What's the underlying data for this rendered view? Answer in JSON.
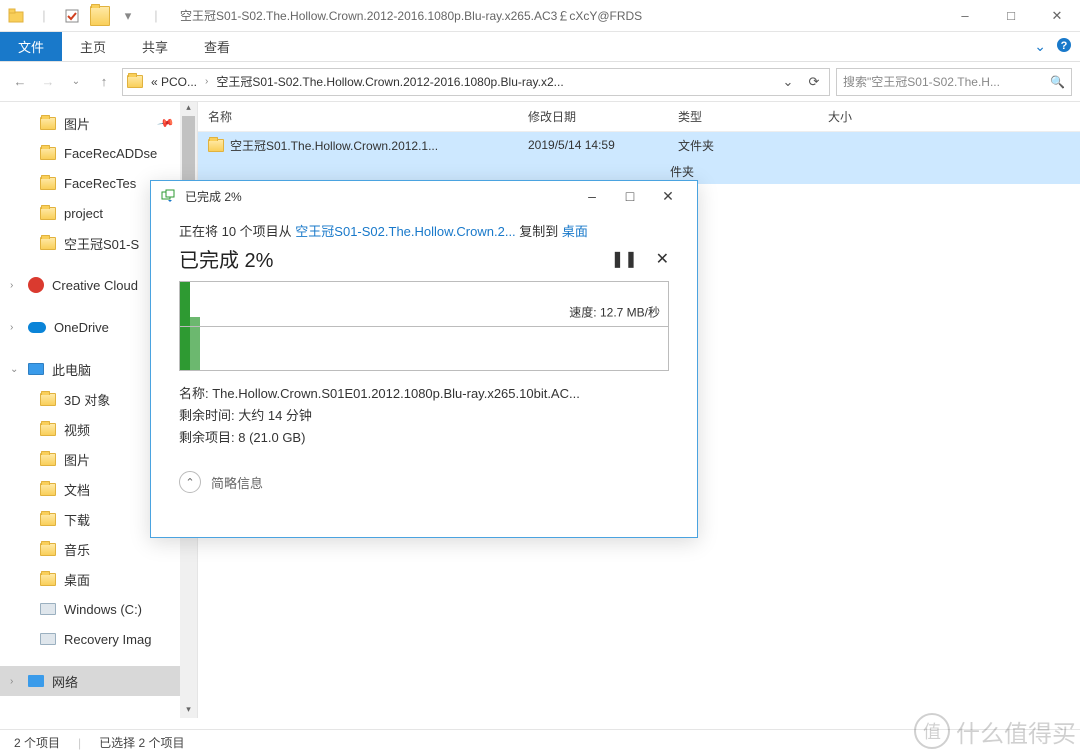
{
  "titlebar": {
    "title": "空王冠S01-S02.The.Hollow.Crown.2012-2016.1080p.Blu-ray.x265.AC3￡cXcY@FRDS"
  },
  "ribbon": {
    "file": "文件",
    "tabs": [
      "主页",
      "共享",
      "查看"
    ]
  },
  "address": {
    "crumb1": "« PCO...",
    "crumb2": "空王冠S01-S02.The.Hollow.Crown.2012-2016.1080p.Blu-ray.x2...",
    "search_placeholder": "搜索\"空王冠S01-S02.The.H..."
  },
  "nav": {
    "items": [
      {
        "label": "图片",
        "pin": true,
        "icon": "folder"
      },
      {
        "label": "FaceRecADDse",
        "pin": true,
        "icon": "folder"
      },
      {
        "label": "FaceRecTes",
        "pin": true,
        "icon": "folder"
      },
      {
        "label": "project",
        "pin": true,
        "icon": "folder"
      },
      {
        "label": "空王冠S01-S",
        "pin": true,
        "icon": "folder"
      }
    ],
    "cc": "Creative Cloud",
    "od": "OneDrive",
    "pc": "此电脑",
    "pcsub": [
      "3D 对象",
      "视频",
      "图片",
      "文档",
      "下载",
      "音乐",
      "桌面",
      "Windows (C:)",
      "Recovery Imag"
    ],
    "net": "网络"
  },
  "columns": {
    "name": "名称",
    "date": "修改日期",
    "type": "类型",
    "size": "大小"
  },
  "rows": [
    {
      "name": "空王冠S01.The.Hollow.Crown.2012.1...",
      "date": "2019/5/14 14:59",
      "type": "文件夹"
    },
    {
      "name": "",
      "date": "",
      "type": "件夹"
    }
  ],
  "status": {
    "count": "2 个项目",
    "sel": "已选择 2 个项目"
  },
  "dialog": {
    "title": "已完成 2%",
    "copying_pre": "正在将 10 个项目从 ",
    "copying_src": "空王冠S01-S02.The.Hollow.Crown.2...",
    "copying_mid": " 复制到 ",
    "copying_dst": "桌面",
    "big": "已完成 2%",
    "speed_label": "速度: ",
    "speed_val": "12.7 MB/秒",
    "name_label": "名称: ",
    "name_val": "The.Hollow.Crown.S01E01.2012.1080p.Blu-ray.x265.10bit.AC...",
    "remain_time_label": "剩余时间: ",
    "remain_time_val": "大约 14 分钟",
    "remain_items_label": "剩余项目: ",
    "remain_items_val": "8 (21.0 GB)",
    "less": "简略信息"
  },
  "watermark": "什么值得买"
}
